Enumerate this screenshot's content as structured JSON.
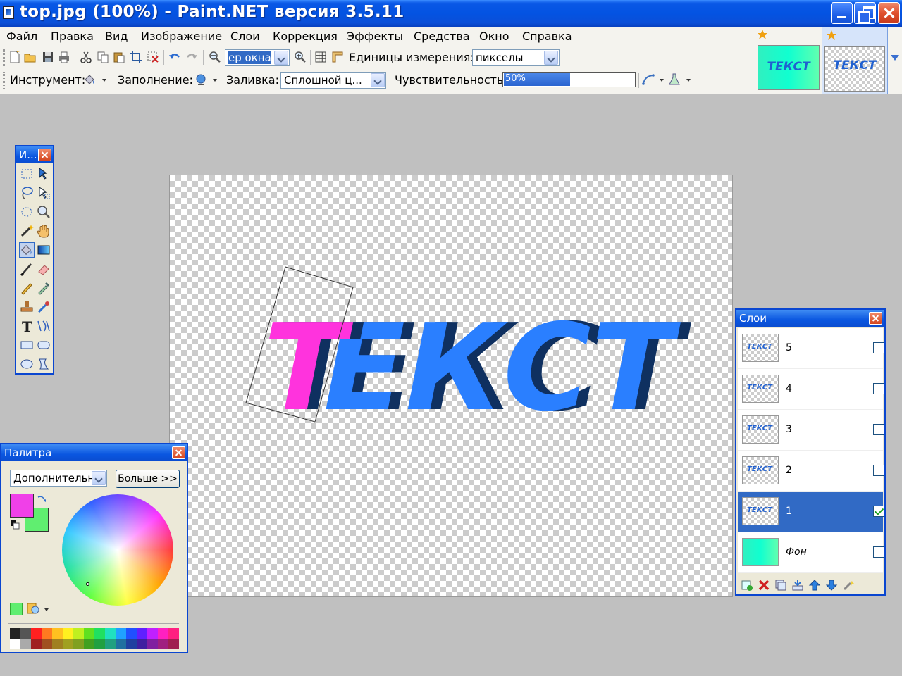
{
  "window": {
    "title": "top.jpg (100%) - Paint.NET версия 3.5.11"
  },
  "menu": [
    "Файл",
    "Правка",
    "Вид",
    "Изображение",
    "Слои",
    "Коррекция",
    "Эффекты",
    "Средства",
    "Окно",
    "Справка"
  ],
  "toolbar1": {
    "zoom_value": "ер окна",
    "units_label": "Единицы измерения:",
    "units_value": "пикселы"
  },
  "toolbar2": {
    "tool_label": "Инструмент:",
    "fill_mode_label": "Заполнение:",
    "fill_label": "Заливка:",
    "fill_value": "Сплошной ц...",
    "tolerance_label": "Чувствительность:",
    "tolerance_value": "50%",
    "tolerance_fraction": 0.5
  },
  "image_tabs": [
    {
      "text": "ТЕКСТ"
    },
    {
      "text": "ТЕКСТ"
    }
  ],
  "tools_window": {
    "title": "И..."
  },
  "canvas": {
    "text_first": "Т",
    "text_rest": "ЕКСТ"
  },
  "palette": {
    "title": "Палитра",
    "mode_value": "Дополнительный",
    "more_button": "Больше >>",
    "primary_color": "#f040e8",
    "secondary_color": "#60ee70"
  },
  "layers": {
    "title": "Слои",
    "items": [
      {
        "name": "5",
        "visible": false,
        "selected": false
      },
      {
        "name": "4",
        "visible": false,
        "selected": false
      },
      {
        "name": "3",
        "visible": false,
        "selected": false
      },
      {
        "name": "2",
        "visible": false,
        "selected": false
      },
      {
        "name": "1",
        "visible": true,
        "selected": true
      },
      {
        "name": "Фон",
        "visible": false,
        "selected": false
      }
    ]
  },
  "colors": {
    "text_blue": "#2a7fff",
    "text_shadow": "#0f3060",
    "text_pink": "#ff33dd",
    "accent": "#316ac5"
  }
}
